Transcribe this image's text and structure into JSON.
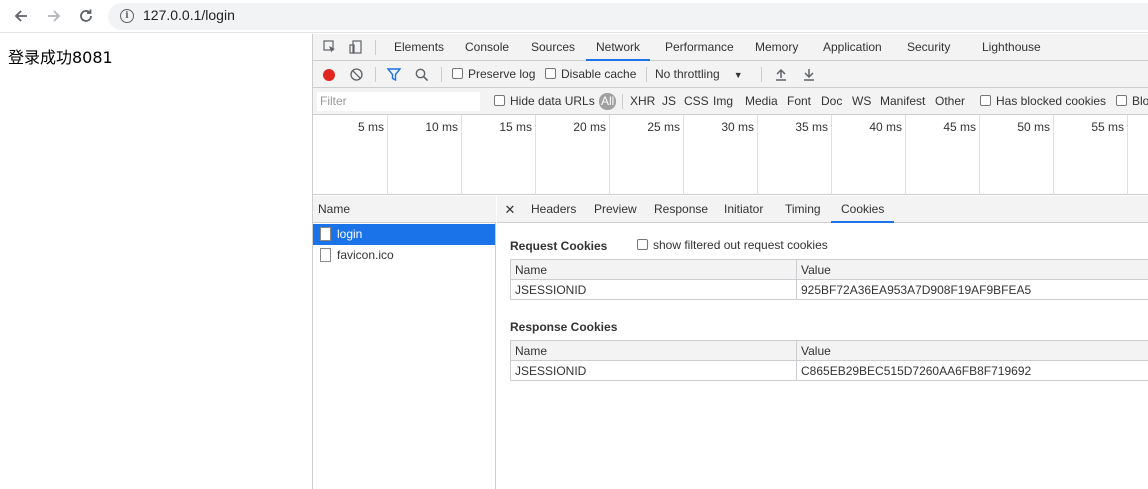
{
  "browser": {
    "url": "127.0.0.1/login"
  },
  "page": {
    "content_text": "登录成功8081"
  },
  "devtools": {
    "tabs": [
      "Elements",
      "Console",
      "Sources",
      "Network",
      "Performance",
      "Memory",
      "Application",
      "Security",
      "Lighthouse"
    ],
    "active_tab": "Network",
    "toolbar": {
      "preserve_log": "Preserve log",
      "disable_cache": "Disable cache",
      "throttling": "No throttling"
    },
    "filter_bar": {
      "filter_placeholder": "Filter",
      "hide_data_urls": "Hide data URLs",
      "all": "All",
      "types": [
        "XHR",
        "JS",
        "CSS",
        "Img",
        "Media",
        "Font",
        "Doc",
        "WS",
        "Manifest",
        "Other"
      ],
      "has_blocked_cookies": "Has blocked cookies",
      "blocked_requests": "Blo"
    },
    "timeline_ticks": [
      "5 ms",
      "10 ms",
      "15 ms",
      "20 ms",
      "25 ms",
      "30 ms",
      "35 ms",
      "40 ms",
      "45 ms",
      "50 ms",
      "55 ms"
    ],
    "request_list": {
      "header": "Name",
      "items": [
        "login",
        "favicon.ico"
      ],
      "selected": "login"
    },
    "detail_tabs": [
      "Headers",
      "Preview",
      "Response",
      "Initiator",
      "Timing",
      "Cookies"
    ],
    "detail_active_tab": "Cookies",
    "request_cookies": {
      "title": "Request Cookies",
      "show_filtered": "show filtered out request cookies",
      "columns": [
        "Name",
        "Value"
      ],
      "rows": [
        [
          "JSESSIONID",
          "925BF72A36EA953A7D908F19AF9BFEA5"
        ]
      ]
    },
    "response_cookies": {
      "title": "Response Cookies",
      "columns": [
        "Name",
        "Value"
      ],
      "rows": [
        [
          "JSESSIONID",
          "C865EB29BEC515D7260AA6FB8F719692"
        ]
      ]
    }
  }
}
